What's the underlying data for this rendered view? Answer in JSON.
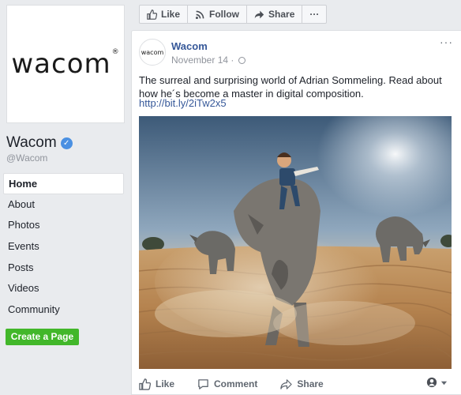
{
  "page": {
    "logo_text": "wacom",
    "name": "Wacom",
    "handle": "@Wacom"
  },
  "nav": [
    {
      "label": "Home",
      "active": true
    },
    {
      "label": "About"
    },
    {
      "label": "Photos"
    },
    {
      "label": "Events"
    },
    {
      "label": "Posts"
    },
    {
      "label": "Videos"
    },
    {
      "label": "Community"
    }
  ],
  "create_page_label": "Create a Page",
  "action_bar": {
    "like": "Like",
    "follow": "Follow",
    "share": "Share",
    "more": "···"
  },
  "post": {
    "avatar_text": "wacom",
    "author": "Wacom",
    "date": "November 14 · ",
    "more": "···",
    "text": "The surreal and surprising world of Adrian Sommeling. Read about how he´s become a master in digital composition.",
    "link": "http://bit.ly/2iTw2x5"
  },
  "footer": {
    "like": "Like",
    "comment": "Comment",
    "share": "Share"
  },
  "colors": {
    "link": "#365899",
    "green": "#42b72a",
    "verified": "#4a90e2"
  }
}
